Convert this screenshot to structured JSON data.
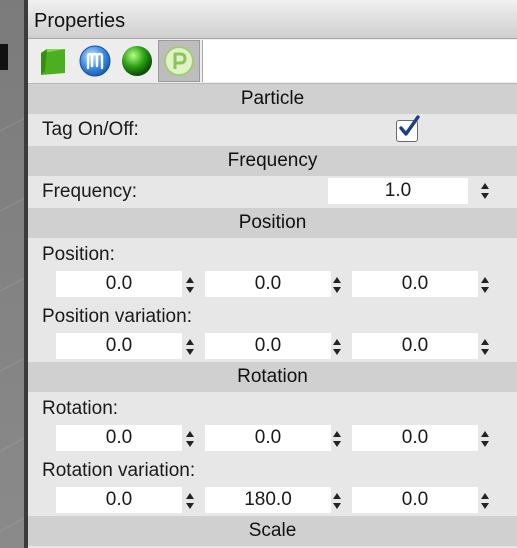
{
  "panel": {
    "title": "Properties"
  },
  "tags": [
    {
      "icon": "green-cube-icon"
    },
    {
      "icon": "motion-tag-icon"
    },
    {
      "icon": "green-sphere-icon"
    },
    {
      "icon": "particle-tag-icon",
      "selected": true
    }
  ],
  "sections": {
    "particle": {
      "header": "Particle",
      "tag_toggle": {
        "label": "Tag On/Off:",
        "checked": true
      }
    },
    "frequency": {
      "header": "Frequency",
      "frequency": {
        "label": "Frequency:",
        "value": "1.0"
      }
    },
    "position": {
      "header": "Position",
      "position": {
        "label": "Position:",
        "x": "0.0",
        "y": "0.0",
        "z": "0.0"
      },
      "position_variation": {
        "label": "Position variation:",
        "x": "0.0",
        "y": "0.0",
        "z": "0.0"
      }
    },
    "rotation": {
      "header": "Rotation",
      "rotation": {
        "label": "Rotation:",
        "x": "0.0",
        "y": "0.0",
        "z": "0.0"
      },
      "rotation_variation": {
        "label": "Rotation variation:",
        "x": "0.0",
        "y": "180.0",
        "z": "0.0"
      }
    },
    "scale": {
      "header": "Scale"
    }
  },
  "colors": {
    "panel_bg": "#e7e7e7",
    "section_bg": "#d0d0d0",
    "checkmark": "#1c3f8a"
  }
}
